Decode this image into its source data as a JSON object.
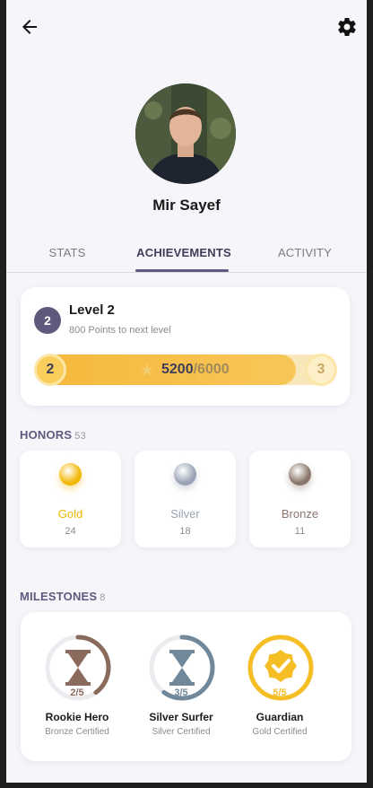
{
  "profile": {
    "name": "Mir Sayef"
  },
  "tabs": [
    {
      "label": "STATS"
    },
    {
      "label": "ACHIEVEMENTS"
    },
    {
      "label": "ACTIVITY"
    }
  ],
  "active_tab": "ACHIEVEMENTS",
  "level": {
    "badge": "2",
    "title": "Level 2",
    "subtitle": "800 Points to next level",
    "current_level": "2",
    "next_level": "3",
    "points_current": "5200",
    "points_total": "/6000",
    "progress_fraction": 0.867
  },
  "honors": {
    "title": "HONORS",
    "count": "53",
    "items": [
      {
        "label": "Gold",
        "count": "24",
        "color": "#f2b705"
      },
      {
        "label": "Silver",
        "count": "18",
        "color": "#9aa3b5"
      },
      {
        "label": "Bronze",
        "count": "11",
        "color": "#8a766a"
      }
    ]
  },
  "milestones": {
    "title": "MILESTONES",
    "count": "8",
    "items": [
      {
        "fraction": "2/5",
        "title": "Rookie Hero",
        "subtitle": "Bronze Certified",
        "progress": 0.4,
        "color": "#8a6a5c",
        "icon": "hourglass-icon"
      },
      {
        "fraction": "3/5",
        "title": "Silver Surfer",
        "subtitle": "Silver Certified",
        "progress": 0.6,
        "color": "#70889a",
        "icon": "hourglass-icon"
      },
      {
        "fraction": "5/5",
        "title": "Guardian",
        "subtitle": "Gold Certified",
        "progress": 1.0,
        "color": "#f4be24",
        "icon": "check-badge-icon"
      }
    ]
  }
}
